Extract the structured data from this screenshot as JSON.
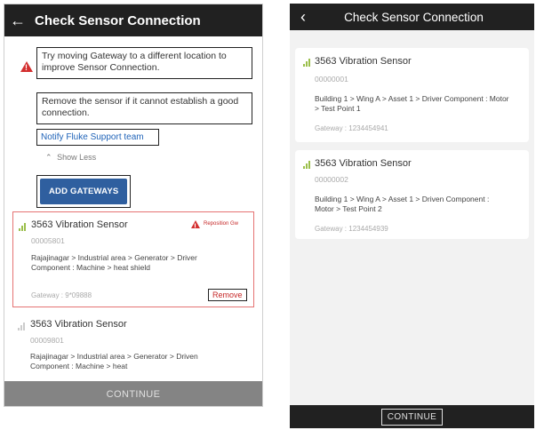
{
  "left": {
    "title": "Check Sensor Connection",
    "message_1": "Try moving Gateway to a different location to improve Sensor Connection.",
    "message_2": "Remove the sensor if it cannot establish a good connection.",
    "support_link": "Notify Fluke Support team",
    "show_less": "Show Less",
    "add_gateways": "ADD GATEWAYS",
    "warning_tag": "Reposition Gw",
    "cards": [
      {
        "name": "3563 Vibration Sensor",
        "id": "00005801",
        "path": "Rajajinagar > Industrial area > Generator > Driver Component : Machine > heat shield",
        "gateway": "Gateway : 9*09888",
        "remove": "Remove"
      },
      {
        "name": "3563 Vibration Sensor",
        "id": "00009801",
        "path": "Rajajinagar > Industrial area > Generator > Driven Component : Machine > heat",
        "gateway": ""
      }
    ],
    "continue": "CONTINUE"
  },
  "right": {
    "title": "Check Sensor Connection",
    "cards": [
      {
        "name": "3563 Vibration Sensor",
        "id": "00000001",
        "path": "Building 1 > Wing A > Asset 1 > Driver Component : Motor > Test Point 1",
        "gateway": "Gateway : 1234454941"
      },
      {
        "name": "3563 Vibration Sensor",
        "id": "00000002",
        "path": "Building 1 > Wing A > Asset 1 > Driven Component : Motor > Test Point 2",
        "gateway": "Gateway : 1234454939"
      }
    ],
    "continue": "CONTINUE"
  },
  "colors": {
    "appbar": "#212121",
    "warning": "#d32f2f",
    "link": "#1f63b8",
    "button": "#2f5f9f",
    "signal": "#9bbf4b"
  }
}
